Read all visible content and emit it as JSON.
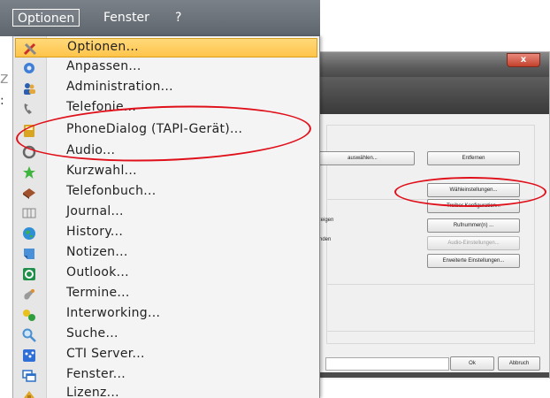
{
  "menubar": {
    "items": [
      {
        "label": "Optionen",
        "active": true
      },
      {
        "label": "Fenster",
        "active": false
      },
      {
        "label": "?",
        "active": false
      }
    ]
  },
  "menu": {
    "items": [
      {
        "label": "Optionen...",
        "icon": "tools-icon",
        "highlighted": true
      },
      {
        "label": "Anpassen...",
        "icon": "gear-icon"
      },
      {
        "label": "Administration...",
        "icon": "users-icon"
      },
      {
        "label": "Telefonie...",
        "icon": "phone-icon"
      },
      {
        "label": "PhoneDialog (TAPI-Gerät)...",
        "icon": "phone-device-icon"
      },
      {
        "label": "Audio...",
        "icon": "audio-icon"
      },
      {
        "label": "Kurzwahl...",
        "icon": "star-icon"
      },
      {
        "label": "Telefonbuch...",
        "icon": "book-icon"
      },
      {
        "label": "Journal...",
        "icon": "journal-icon"
      },
      {
        "label": "History...",
        "icon": "globe-icon"
      },
      {
        "label": "Notizen...",
        "icon": "notes-icon"
      },
      {
        "label": "Outlook...",
        "icon": "outlook-icon"
      },
      {
        "label": "Termine...",
        "icon": "calendar-icon"
      },
      {
        "label": "Interworking...",
        "icon": "interworking-icon"
      },
      {
        "label": "Suche...",
        "icon": "search-icon"
      },
      {
        "label": "CTI Server...",
        "icon": "server-icon"
      },
      {
        "label": "Fenster...",
        "icon": "windows-icon"
      },
      {
        "label": "Lizenz...",
        "icon": "license-icon"
      }
    ]
  },
  "dialog": {
    "close_label": "x",
    "buttons": {
      "auswaehlen": "auswählen...",
      "entfernen": "Entfernen",
      "waehleinstellungen": "Wähleinstellungen...",
      "treiber": "Treiber Konfiguration...",
      "rufnummer": "Rufnummer(n) ...",
      "audio_einstellungen": "Audio-Einstellungen...",
      "erweiterte": "Erweiterte Einstellungen...",
      "ok": "Ok",
      "abbruch": "Abbruch"
    },
    "labels": {
      "anzeigen": "anzeigen",
      "nte": "nte",
      "blenden": "blenden"
    }
  },
  "fragments": {
    "left_z": "z",
    "left_colon": ":"
  },
  "colors": {
    "highlight_ring": "#e0101a",
    "menu_highlight": "#ffc54a",
    "menubar": "#6a7078"
  }
}
